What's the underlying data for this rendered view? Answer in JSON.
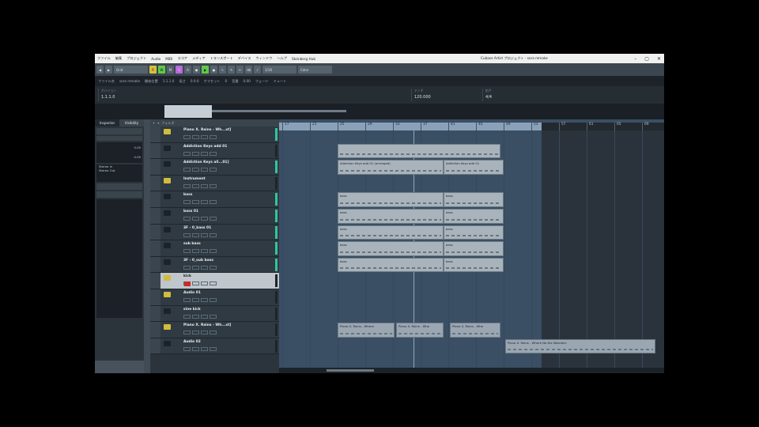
{
  "window": {
    "title": "Cubase Artist プロジェクト - sora remake",
    "menu": [
      "ファイル",
      "編集",
      "プロジェクト",
      "Audio",
      "MIDI",
      "スコア",
      "メディア",
      "トランスポート",
      "デバイス",
      "ウィンドウ",
      "ヘルプ",
      "Steinberg Hub"
    ]
  },
  "toolbar": {
    "buttons": [
      "◀",
      "▶",
      "●",
      "⟲",
      "R",
      "W",
      "M",
      "S",
      "A",
      "◼",
      "▶",
      "●",
      "↖",
      "✎",
      "✂",
      "⌫",
      "♪"
    ],
    "mode_label": "Grid",
    "quantize": "1/16",
    "color": "Color"
  },
  "infoline": {
    "fields": [
      "ファイル名",
      "sora remake",
      "開始位置",
      "1.1.1.0",
      "長さ",
      "0.0.0",
      "オフセット",
      "0",
      "音量",
      "0.00",
      "フェード",
      "ミュート"
    ]
  },
  "transport": {
    "position_label": "ポジション",
    "position": "1.1.1.0",
    "tempo_label": "テンポ",
    "tempo": "120.000",
    "signature_label": "拍子",
    "signature": "4/4"
  },
  "inspector": {
    "tab_left": "Inspector",
    "tab_right": "Visibility",
    "value1": "0.00",
    "value2": "0.00",
    "text1": "Stereo In",
    "text2": "Stereo Out"
  },
  "tracklist": {
    "header": [
      "+",
      "▾",
      "フォルダ"
    ],
    "tracks": [
      {
        "name": "Piano X. Rains - Wh...xt]",
        "icon": "y",
        "meter": true
      },
      {
        "name": "Addiction Keys add 01",
        "icon": "k",
        "meter": false
      },
      {
        "name": "Addiction Keys all...01]",
        "icon": "k",
        "meter": true
      },
      {
        "name": "Instrument",
        "icon": "y",
        "meter": false
      },
      {
        "name": "bass",
        "icon": "k",
        "meter": true
      },
      {
        "name": "bass 01",
        "icon": "k",
        "meter": true
      },
      {
        "name": "3F - 0_bass 01",
        "icon": "k",
        "meter": true
      },
      {
        "name": "sub bass",
        "icon": "k",
        "meter": true
      },
      {
        "name": "3F - 0_sub bass",
        "icon": "k",
        "meter": true
      },
      {
        "name": "kick",
        "icon": "y",
        "meter": false,
        "selected": true
      },
      {
        "name": "Audio 01",
        "icon": "y",
        "meter": false
      },
      {
        "name": "sine kick",
        "icon": "k",
        "meter": false
      },
      {
        "name": "Piano X. Rains - Wh...xt]",
        "icon": "y",
        "meter": false
      },
      {
        "name": "Audio 02",
        "icon": "k",
        "meter": false
      }
    ]
  },
  "ruler": {
    "bars": [
      "17",
      "21",
      "25",
      "29",
      "33",
      "37",
      "41",
      "45",
      "49",
      "53",
      "57",
      "61",
      "65",
      "69"
    ]
  },
  "parts": [
    {
      "label": "",
      "row": 1
    },
    {
      "label": "Addiction Keys add 01 (arranged)",
      "row": 2
    },
    {
      "label": "Addiction Keys add 01",
      "row": 2
    },
    {
      "label": "bass",
      "row": 4
    },
    {
      "label": "bass",
      "row": 4
    },
    {
      "label": "bass",
      "row": 5
    },
    {
      "label": "bass",
      "row": 5
    },
    {
      "label": "bass",
      "row": 6
    },
    {
      "label": "bass",
      "row": 6
    },
    {
      "label": "bass",
      "row": 7
    },
    {
      "label": "bass",
      "row": 7
    },
    {
      "label": "bass",
      "row": 8
    },
    {
      "label": "bass",
      "row": 8
    },
    {
      "label": "Piano X. Rains - Where",
      "row": 12
    },
    {
      "label": "Piano X. Rains - Whe",
      "row": 12
    },
    {
      "label": "Piano X. Rains - Whe",
      "row": 12
    },
    {
      "label": "Piano X. Rains - Where No the Wonders",
      "row": 13
    }
  ],
  "colors": {
    "accent": "#d2bc3a",
    "record": "#cc2a2a",
    "meter": "#34c49c",
    "arrange_bg": "#3a4f64"
  }
}
